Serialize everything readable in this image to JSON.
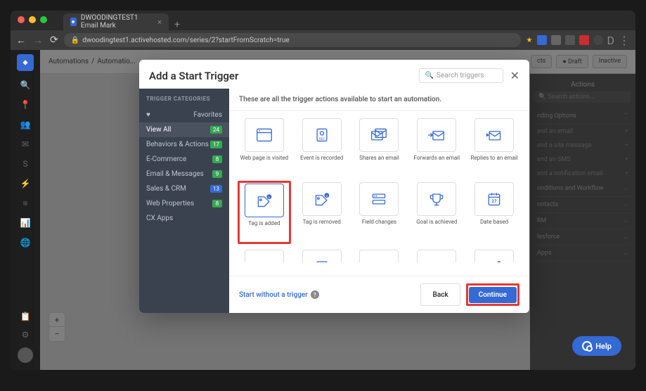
{
  "browser": {
    "tab_title": "DWOODINGTEST1 Email Mark",
    "url": "dwoodingtest1.activehosted.com/series/2?startFromScratch=true"
  },
  "breadcrumb": {
    "root": "Automations",
    "current": "Automatio..."
  },
  "top_buttons": {
    "draft": "Draft",
    "inactive": "Inactive"
  },
  "right_panel": {
    "title": "Actions",
    "search_placeholder": "Search actions...",
    "sections": [
      {
        "label": "nding Options",
        "items": [
          "end an email",
          "end a site message",
          "end an SMS",
          "end a notification email"
        ]
      },
      {
        "label": "onditions and Workflow",
        "items": []
      },
      {
        "label": "ontacts",
        "items": []
      },
      {
        "label": "RM",
        "items": []
      },
      {
        "label": "lesforce",
        "items": []
      },
      {
        "label": "Apps",
        "items": []
      }
    ]
  },
  "modal": {
    "title": "Add a Start Trigger",
    "search_placeholder": "Search triggers",
    "categories_header": "TRIGGER CATEGORIES",
    "favorites_label": "Favorites",
    "categories": [
      {
        "label": "View All",
        "badge": "24",
        "active": true
      },
      {
        "label": "Behaviors & Actions",
        "badge": "17"
      },
      {
        "label": "E-Commerce",
        "badge": "8"
      },
      {
        "label": "Email & Messages",
        "badge": "9"
      },
      {
        "label": "Sales & CRM",
        "badge": "13"
      },
      {
        "label": "Web Properties",
        "badge": "8"
      },
      {
        "label": "CX Apps",
        "badge": ""
      }
    ],
    "description": "These are all the trigger actions available to start an automation.",
    "triggers": [
      {
        "label": "Web page is visited",
        "icon": "webpage"
      },
      {
        "label": "Event is recorded",
        "icon": "record"
      },
      {
        "label": "Shares an email",
        "icon": "share-email"
      },
      {
        "label": "Forwards an email",
        "icon": "forward-email"
      },
      {
        "label": "Replies to an email",
        "icon": "reply-email"
      },
      {
        "label": "Tag is added",
        "icon": "tag-add",
        "highlighted": true
      },
      {
        "label": "Tag is removed",
        "icon": "tag-remove"
      },
      {
        "label": "Field changes",
        "icon": "field"
      },
      {
        "label": "Goal is achieved",
        "icon": "goal"
      },
      {
        "label": "Date based",
        "icon": "date"
      }
    ],
    "footer": {
      "start_without": "Start without a trigger",
      "back": "Back",
      "continue": "Continue"
    }
  },
  "help_label": "Help"
}
